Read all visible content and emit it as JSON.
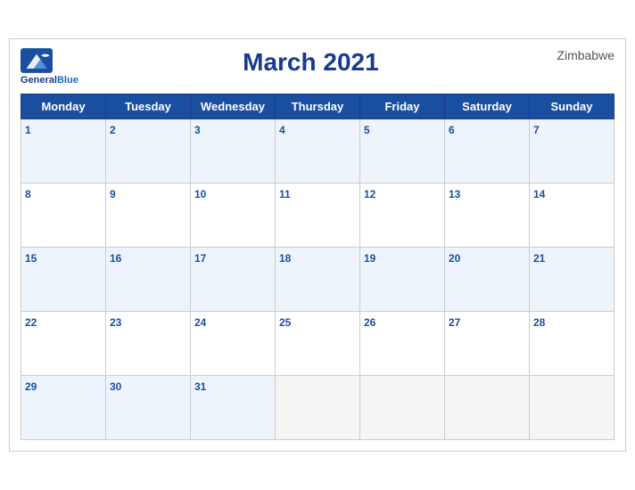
{
  "header": {
    "title": "March 2021",
    "country": "Zimbabwe",
    "logo": {
      "general": "General",
      "blue": "Blue"
    }
  },
  "weekdays": [
    "Monday",
    "Tuesday",
    "Wednesday",
    "Thursday",
    "Friday",
    "Saturday",
    "Sunday"
  ],
  "weeks": [
    [
      1,
      2,
      3,
      4,
      5,
      6,
      7
    ],
    [
      8,
      9,
      10,
      11,
      12,
      13,
      14
    ],
    [
      15,
      16,
      17,
      18,
      19,
      20,
      21
    ],
    [
      22,
      23,
      24,
      25,
      26,
      27,
      28
    ],
    [
      29,
      30,
      31,
      null,
      null,
      null,
      null
    ]
  ]
}
